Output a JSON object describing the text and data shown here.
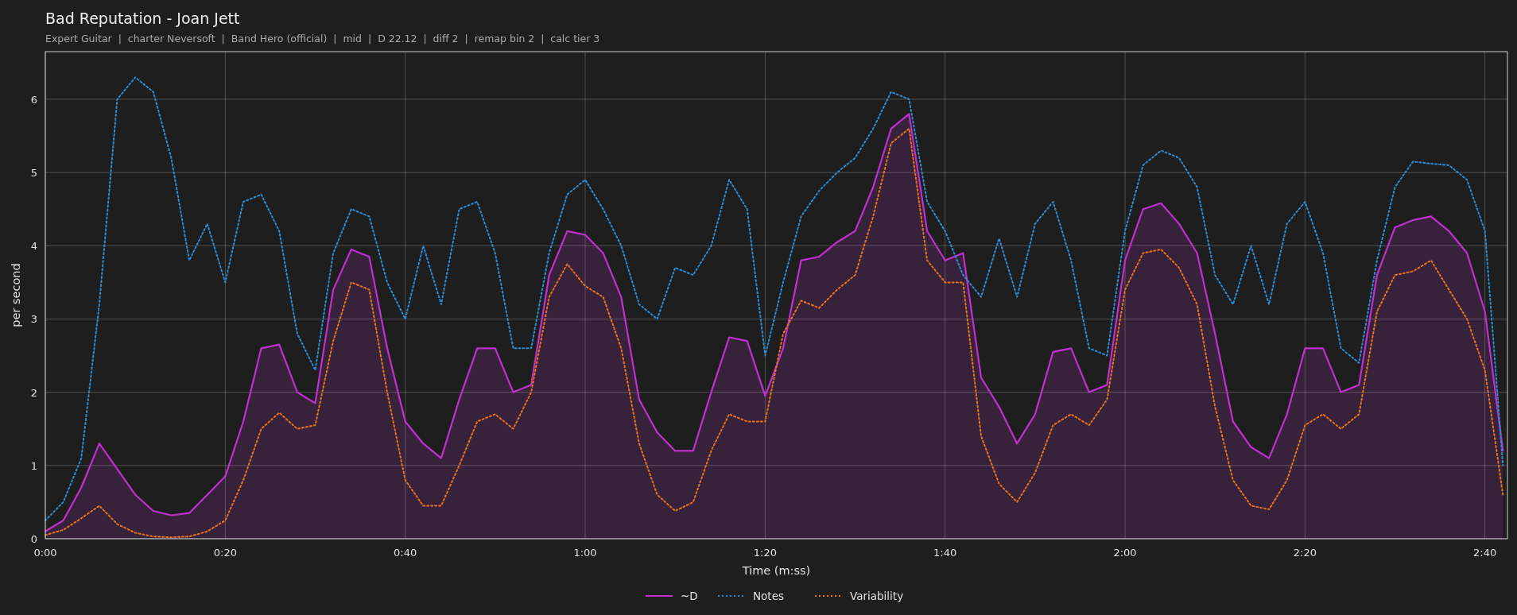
{
  "title": "Bad Reputation - Joan Jett",
  "subtitle": "Expert Guitar  |  charter Neversoft  |  Band Hero (official)  |  mid  |  D 22.12  |  diff 2  |  remap bin 2  |  calc tier 3",
  "chart_data": {
    "type": "line",
    "grid": true,
    "legend": true,
    "xlabel": "Time (m:ss)",
    "ylabel": "per second",
    "xlim": [
      0,
      162.5
    ],
    "ylim": [
      0,
      6.65
    ],
    "xticks": [
      {
        "value": 0,
        "label": "0:00"
      },
      {
        "value": 20,
        "label": "0:20"
      },
      {
        "value": 40,
        "label": "0:40"
      },
      {
        "value": 60,
        "label": "1:00"
      },
      {
        "value": 80,
        "label": "1:20"
      },
      {
        "value": 100,
        "label": "1:40"
      },
      {
        "value": 120,
        "label": "2:00"
      },
      {
        "value": 140,
        "label": "2:20"
      },
      {
        "value": 160,
        "label": "2:40"
      }
    ],
    "yticks": [
      0,
      1,
      2,
      3,
      4,
      5,
      6
    ],
    "x": [
      0,
      2,
      4,
      6,
      8,
      10,
      12,
      14,
      16,
      18,
      20,
      22,
      24,
      26,
      28,
      30,
      32,
      34,
      36,
      38,
      40,
      42,
      44,
      46,
      48,
      50,
      52,
      54,
      56,
      58,
      60,
      62,
      64,
      66,
      68,
      70,
      72,
      74,
      76,
      78,
      80,
      82,
      84,
      86,
      88,
      90,
      92,
      94,
      96,
      98,
      100,
      102,
      104,
      106,
      108,
      110,
      112,
      114,
      116,
      118,
      120,
      122,
      124,
      126,
      128,
      130,
      132,
      134,
      136,
      138,
      140,
      142,
      144,
      146,
      148,
      150,
      152,
      154,
      156,
      158,
      160,
      162
    ],
    "series": [
      {
        "name": "~D",
        "color": "#c22fd0",
        "line_style": "solid",
        "type": "area",
        "values": [
          0.1,
          0.25,
          0.7,
          1.3,
          0.95,
          0.6,
          0.38,
          0.32,
          0.35,
          0.6,
          0.85,
          1.6,
          2.6,
          2.65,
          2.0,
          1.85,
          3.4,
          3.95,
          3.85,
          2.6,
          1.6,
          1.3,
          1.1,
          1.9,
          2.6,
          2.6,
          2.0,
          2.1,
          3.6,
          4.2,
          4.15,
          3.9,
          3.3,
          1.9,
          1.45,
          1.2,
          1.2,
          2.0,
          2.75,
          2.7,
          1.95,
          2.6,
          3.8,
          3.85,
          4.05,
          4.2,
          4.8,
          5.6,
          5.8,
          4.2,
          3.8,
          3.9,
          2.2,
          1.8,
          1.3,
          1.7,
          2.55,
          2.6,
          2.0,
          2.1,
          3.8,
          4.5,
          4.58,
          4.3,
          3.9,
          2.8,
          1.6,
          1.25,
          1.1,
          1.7,
          2.6,
          2.6,
          2.0,
          2.1,
          3.6,
          4.25,
          4.35,
          4.4,
          4.2,
          3.9,
          3.1,
          1.2
        ]
      },
      {
        "name": "Notes",
        "color": "#2b8cd6",
        "line_style": "dotted",
        "type": "line",
        "values": [
          0.25,
          0.5,
          1.1,
          3.2,
          6.0,
          6.3,
          6.1,
          5.2,
          3.8,
          4.3,
          3.5,
          4.6,
          4.7,
          4.2,
          2.8,
          2.3,
          3.9,
          4.5,
          4.4,
          3.5,
          3.0,
          4.0,
          3.2,
          4.5,
          4.6,
          3.9,
          2.6,
          2.6,
          3.9,
          4.7,
          4.9,
          4.5,
          4.0,
          3.2,
          3.0,
          3.7,
          3.6,
          4.0,
          4.9,
          4.5,
          2.5,
          3.5,
          4.4,
          4.75,
          5.0,
          5.2,
          5.6,
          6.1,
          6.0,
          4.6,
          4.2,
          3.6,
          3.3,
          4.1,
          3.3,
          4.3,
          4.6,
          3.8,
          2.6,
          2.5,
          4.2,
          5.1,
          5.3,
          5.2,
          4.8,
          3.6,
          3.2,
          4.0,
          3.2,
          4.3,
          4.6,
          3.9,
          2.6,
          2.4,
          3.8,
          4.8,
          5.15,
          5.12,
          5.1,
          4.9,
          4.2,
          1.0
        ]
      },
      {
        "name": "Variability",
        "color": "#e8731c",
        "line_style": "dotted",
        "type": "line",
        "values": [
          0.05,
          0.12,
          0.28,
          0.45,
          0.2,
          0.08,
          0.03,
          0.02,
          0.03,
          0.1,
          0.25,
          0.8,
          1.5,
          1.72,
          1.5,
          1.55,
          2.7,
          3.5,
          3.4,
          2.0,
          0.8,
          0.45,
          0.45,
          1.0,
          1.6,
          1.7,
          1.5,
          2.0,
          3.3,
          3.75,
          3.45,
          3.3,
          2.6,
          1.3,
          0.6,
          0.38,
          0.5,
          1.2,
          1.7,
          1.6,
          1.6,
          2.8,
          3.25,
          3.15,
          3.4,
          3.6,
          4.4,
          5.4,
          5.6,
          3.8,
          3.5,
          3.5,
          1.4,
          0.75,
          0.5,
          0.9,
          1.55,
          1.7,
          1.55,
          1.9,
          3.4,
          3.9,
          3.95,
          3.7,
          3.2,
          1.8,
          0.8,
          0.45,
          0.4,
          0.8,
          1.55,
          1.7,
          1.5,
          1.7,
          3.1,
          3.6,
          3.65,
          3.8,
          3.4,
          3.0,
          2.3,
          0.6
        ]
      }
    ]
  }
}
